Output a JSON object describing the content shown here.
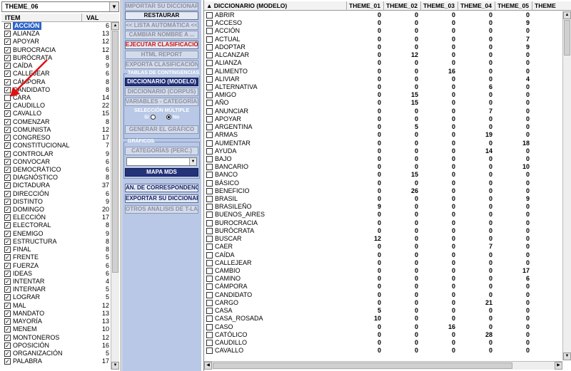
{
  "left": {
    "theme_select": "THEME_06",
    "col_item": "ITEM",
    "col_val": "VAL",
    "items": [
      {
        "label": "ACCIÓN",
        "value": "6",
        "checked": true,
        "selected": true
      },
      {
        "label": "ALIANZA",
        "value": "13",
        "checked": true
      },
      {
        "label": "APOYAR",
        "value": "12",
        "checked": true
      },
      {
        "label": "BUROCRACIA",
        "value": "12",
        "checked": true
      },
      {
        "label": "BURÓCRATA",
        "value": "8",
        "checked": true
      },
      {
        "label": "CAÍDA",
        "value": "9",
        "checked": true
      },
      {
        "label": "CALLEJEAR",
        "value": "6",
        "checked": true
      },
      {
        "label": "CÁMPORA",
        "value": "8",
        "checked": true
      },
      {
        "label": "CANDIDATO",
        "value": "8",
        "checked": true
      },
      {
        "label": "CARA",
        "value": "14",
        "checked": false
      },
      {
        "label": "CAUDILLO",
        "value": "22",
        "checked": true
      },
      {
        "label": "CAVALLO",
        "value": "15",
        "checked": true
      },
      {
        "label": "COMENZAR",
        "value": "8",
        "checked": true
      },
      {
        "label": "COMUNISTA",
        "value": "12",
        "checked": true
      },
      {
        "label": "CONGRESO",
        "value": "17",
        "checked": true
      },
      {
        "label": "CONSTITUCIONAL",
        "value": "7",
        "checked": true
      },
      {
        "label": "CONTROLAR",
        "value": "9",
        "checked": true
      },
      {
        "label": "CONVOCAR",
        "value": "6",
        "checked": true
      },
      {
        "label": "DEMOCRÁTICO",
        "value": "6",
        "checked": true
      },
      {
        "label": "DIAGNÓSTICO",
        "value": "8",
        "checked": true
      },
      {
        "label": "DICTADURA",
        "value": "37",
        "checked": true
      },
      {
        "label": "DIRECCIÓN",
        "value": "6",
        "checked": true
      },
      {
        "label": "DISTINTO",
        "value": "9",
        "checked": true
      },
      {
        "label": "DOMINGO",
        "value": "20",
        "checked": true
      },
      {
        "label": "ELECCIÓN",
        "value": "17",
        "checked": true
      },
      {
        "label": "ELECTORAL",
        "value": "8",
        "checked": true
      },
      {
        "label": "ENEMIGO",
        "value": "9",
        "checked": true
      },
      {
        "label": "ESTRUCTURA",
        "value": "8",
        "checked": true
      },
      {
        "label": "FINAL",
        "value": "8",
        "checked": true
      },
      {
        "label": "FRENTE",
        "value": "5",
        "checked": true
      },
      {
        "label": "FUERZA",
        "value": "6",
        "checked": true
      },
      {
        "label": "IDEAS",
        "value": "6",
        "checked": true
      },
      {
        "label": "INTENTAR",
        "value": "4",
        "checked": true
      },
      {
        "label": "INTERNAR",
        "value": "5",
        "checked": true
      },
      {
        "label": "LOGRAR",
        "value": "5",
        "checked": true
      },
      {
        "label": "MAL",
        "value": "12",
        "checked": true
      },
      {
        "label": "MANDATO",
        "value": "13",
        "checked": true
      },
      {
        "label": "MAYORÍA",
        "value": "13",
        "checked": true
      },
      {
        "label": "MENEM",
        "value": "10",
        "checked": true
      },
      {
        "label": "MONTONEROS",
        "value": "12",
        "checked": true
      },
      {
        "label": "OPOSICIÓN",
        "value": "16",
        "checked": true
      },
      {
        "label": "ORGANIZACIÓN",
        "value": "5",
        "checked": true
      },
      {
        "label": "PALABRA",
        "value": "17",
        "checked": true
      }
    ]
  },
  "mid": {
    "importar": "IMPORTAR SU DICCIONARIO",
    "restaurar": "RESTAURAR",
    "lista": "<< LISTA AUTOMÁTICA <<",
    "cambiar": "CAMBIAR NOMBRE A ...",
    "ejecutar": "EJECUTAR CLASIFICACIÓN",
    "html": "HTML REPORT",
    "exportar_clas": "EXPORTA CLASIFICACIÓN",
    "tablas_title": "TABLAS DE CONTINGENCIAS",
    "dic_modelo": "DICCIONARIO (MODELO)",
    "dic_corpus": "DICCIONARIO (CORPUS)",
    "variables": "VARIABLES - CATEGORÍAS",
    "seleccion": "SELECCIÓN MÚLTIPLE",
    "si": "Sí",
    "no": "No",
    "generar": "GENERAR EL GRÁFICO",
    "graficos_title": "GRÁFICOS",
    "categorias": "CATEGORÍAS (PERC.)",
    "mapa": "MAPA MDS",
    "an_corr": "AN. DE CORRESPONDENCIAS",
    "exportar_dic": "EXPORTAR SU DICCIONARIO",
    "otros": "OTROS ANÁLISIS DE T-LAB"
  },
  "right": {
    "col_dic": "DICCIONARIO (MODELO)",
    "themes": [
      "THEME_01",
      "THEME_02",
      "THEME_03",
      "THEME_04",
      "THEME_05",
      "THEME"
    ],
    "rows": [
      {
        "w": "ABRIR",
        "v": [
          0,
          0,
          0,
          0,
          0
        ]
      },
      {
        "w": "ACCESO",
        "v": [
          0,
          0,
          0,
          0,
          9
        ]
      },
      {
        "w": "ACCIÓN",
        "v": [
          0,
          0,
          0,
          0,
          0
        ]
      },
      {
        "w": "ACTUAL",
        "v": [
          0,
          0,
          0,
          0,
          7
        ]
      },
      {
        "w": "ADOPTAR",
        "v": [
          0,
          0,
          0,
          0,
          9
        ]
      },
      {
        "w": "ALCANZAR",
        "v": [
          0,
          12,
          0,
          0,
          0
        ]
      },
      {
        "w": "ALIANZA",
        "v": [
          0,
          0,
          0,
          0,
          0
        ]
      },
      {
        "w": "ALIMENTO",
        "v": [
          0,
          0,
          16,
          0,
          0
        ]
      },
      {
        "w": "ALIVIAR",
        "v": [
          0,
          0,
          0,
          0,
          4
        ]
      },
      {
        "w": "ALTERNATIVA",
        "v": [
          0,
          0,
          0,
          6,
          0
        ]
      },
      {
        "w": "AMIGO",
        "v": [
          0,
          15,
          0,
          0,
          0
        ]
      },
      {
        "w": "AÑO",
        "v": [
          0,
          15,
          0,
          0,
          0
        ]
      },
      {
        "w": "ANUNCIAR",
        "v": [
          0,
          0,
          0,
          7,
          0
        ]
      },
      {
        "w": "APOYAR",
        "v": [
          0,
          0,
          0,
          0,
          0
        ]
      },
      {
        "w": "ARGENTINA",
        "v": [
          0,
          5,
          0,
          0,
          0
        ]
      },
      {
        "w": "ARMAS",
        "v": [
          0,
          0,
          0,
          19,
          0
        ]
      },
      {
        "w": "AUMENTAR",
        "v": [
          0,
          0,
          0,
          0,
          18
        ]
      },
      {
        "w": "AYUDA",
        "v": [
          0,
          0,
          0,
          14,
          0
        ]
      },
      {
        "w": "BAJO",
        "v": [
          0,
          0,
          0,
          0,
          0
        ]
      },
      {
        "w": "BANCARIO",
        "v": [
          0,
          0,
          0,
          0,
          10
        ]
      },
      {
        "w": "BANCO",
        "v": [
          0,
          15,
          0,
          0,
          0
        ]
      },
      {
        "w": "BÁSICO",
        "v": [
          0,
          0,
          0,
          0,
          0
        ]
      },
      {
        "w": "BENEFICIO",
        "v": [
          0,
          26,
          0,
          0,
          0
        ]
      },
      {
        "w": "BRASIL",
        "v": [
          0,
          0,
          0,
          0,
          9
        ]
      },
      {
        "w": "BRASILEÑO",
        "v": [
          9,
          0,
          0,
          0,
          0
        ]
      },
      {
        "w": "BUENOS_AIRES",
        "v": [
          0,
          0,
          0,
          0,
          0
        ]
      },
      {
        "w": "BUROCRACIA",
        "v": [
          0,
          0,
          0,
          0,
          0
        ]
      },
      {
        "w": "BURÓCRATA",
        "v": [
          0,
          0,
          0,
          0,
          0
        ]
      },
      {
        "w": "BUSCAR",
        "v": [
          12,
          0,
          0,
          0,
          0
        ]
      },
      {
        "w": "CAER",
        "v": [
          0,
          0,
          0,
          7,
          0
        ]
      },
      {
        "w": "CAÍDA",
        "v": [
          0,
          0,
          0,
          0,
          0
        ]
      },
      {
        "w": "CALLEJEAR",
        "v": [
          0,
          0,
          0,
          0,
          0
        ]
      },
      {
        "w": "CAMBIO",
        "v": [
          0,
          0,
          0,
          0,
          17
        ]
      },
      {
        "w": "CAMINO",
        "v": [
          0,
          0,
          0,
          0,
          6
        ]
      },
      {
        "w": "CÁMPORA",
        "v": [
          0,
          0,
          0,
          0,
          0
        ]
      },
      {
        "w": "CANDIDATO",
        "v": [
          0,
          0,
          0,
          0,
          0
        ]
      },
      {
        "w": "CARGO",
        "v": [
          0,
          0,
          0,
          21,
          0
        ]
      },
      {
        "w": "CASA",
        "v": [
          5,
          0,
          0,
          0,
          0
        ]
      },
      {
        "w": "CASA_ROSADA",
        "v": [
          10,
          0,
          0,
          0,
          0
        ]
      },
      {
        "w": "CASO",
        "v": [
          0,
          0,
          16,
          0,
          0
        ]
      },
      {
        "w": "CATÓLICO",
        "v": [
          0,
          0,
          0,
          28,
          0
        ]
      },
      {
        "w": "CAUDILLO",
        "v": [
          0,
          0,
          0,
          0,
          0
        ]
      },
      {
        "w": "CAVALLO",
        "v": [
          0,
          0,
          0,
          0,
          0
        ]
      }
    ]
  }
}
